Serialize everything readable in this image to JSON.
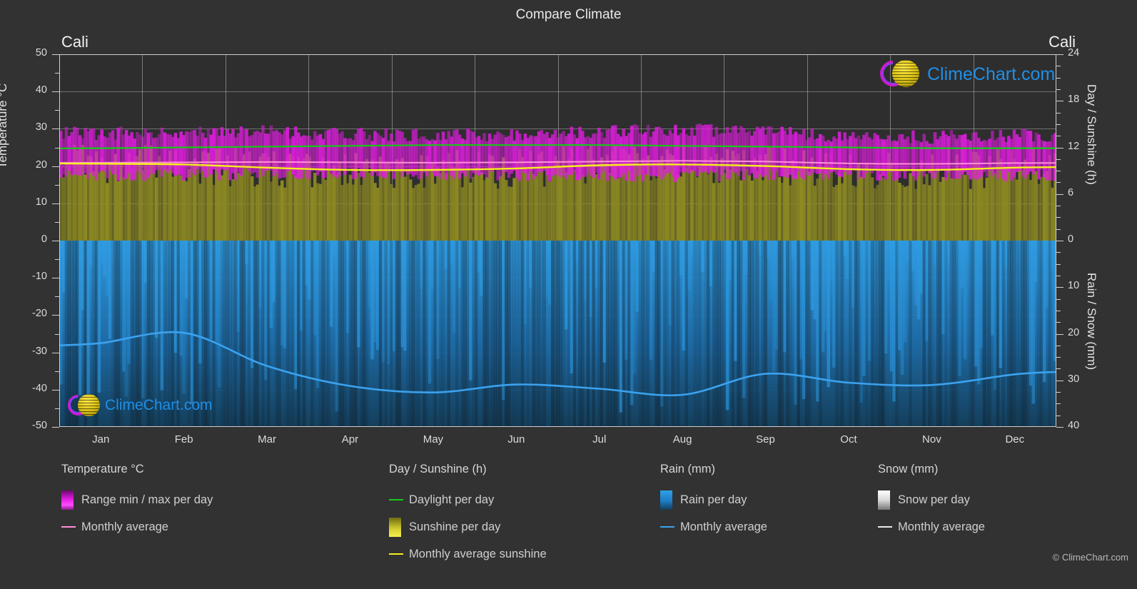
{
  "header": {
    "title": "Compare Climate",
    "location_left": "Cali",
    "location_right": "Cali"
  },
  "axes": {
    "left_title": "Temperature °C",
    "right_title_top": "Day / Sunshine (h)",
    "right_title_bottom": "Rain / Snow (mm)",
    "left_ticks": [
      "50",
      "40",
      "30",
      "20",
      "10",
      "0",
      "-10",
      "-20",
      "-30",
      "-40",
      "-50"
    ],
    "right_ticks_top": [
      "24",
      "18",
      "12",
      "6",
      "0"
    ],
    "right_ticks_bottom": [
      "10",
      "20",
      "30",
      "40"
    ],
    "x_ticks": [
      "Jan",
      "Feb",
      "Mar",
      "Apr",
      "May",
      "Jun",
      "Jul",
      "Aug",
      "Sep",
      "Oct",
      "Nov",
      "Dec"
    ]
  },
  "legend": {
    "temperature": {
      "head": "Temperature °C",
      "items": [
        {
          "label": "Range min / max per day",
          "swatch": "gradient-magenta"
        },
        {
          "label": "Monthly average",
          "swatch": "line-pink"
        }
      ]
    },
    "daysun": {
      "head": "Day / Sunshine (h)",
      "items": [
        {
          "label": "Daylight per day",
          "swatch": "line-green"
        },
        {
          "label": "Sunshine per day",
          "swatch": "gradient-yellow"
        },
        {
          "label": "Monthly average sunshine",
          "swatch": "line-yellow"
        }
      ]
    },
    "rain": {
      "head": "Rain (mm)",
      "items": [
        {
          "label": "Rain per day",
          "swatch": "gradient-blue"
        },
        {
          "label": "Monthly average",
          "swatch": "line-blue"
        }
      ]
    },
    "snow": {
      "head": "Snow (mm)",
      "items": [
        {
          "label": "Snow per day",
          "swatch": "gradient-white"
        },
        {
          "label": "Monthly average",
          "swatch": "line-white"
        }
      ]
    },
    "copyright": "© ClimeChart.com"
  },
  "watermark": {
    "text": "ClimeChart.com"
  },
  "colors": {
    "background": "#323232",
    "plot_background": "#2e2e2e",
    "grid": "#d7d7d7",
    "temp_range": "#e21ce2",
    "temp_avg": "#ff8fd8",
    "daylight": "#16c916",
    "sunshine": "#f2ee3a",
    "sunshine_avg": "#f5ef1e",
    "rain": "#1f8fe8",
    "rain_avg": "#3ba2ef",
    "snow": "#ffffff",
    "logo_text": "#1f8fe8",
    "logo_arc": "#d11ad1",
    "logo_sun": "#ddc416"
  },
  "chart_data": {
    "type": "area",
    "title": "Compare Climate",
    "subtitle": "Cali",
    "xlabel": "",
    "ylabel": "Temperature °C",
    "categories": [
      "Jan",
      "Feb",
      "Mar",
      "Apr",
      "May",
      "Jun",
      "Jul",
      "Aug",
      "Sep",
      "Oct",
      "Nov",
      "Dec"
    ],
    "ylim_temperature_c": [
      -50,
      50
    ],
    "ylim_day_sunshine_h": [
      0,
      24
    ],
    "ylim_rain_snow_mm": [
      0,
      40
    ],
    "grid": true,
    "legend_position": "below",
    "series": [
      {
        "name": "Monthly average temperature (°C)",
        "axis": "temperature",
        "color": "#ff8fd8",
        "values": [
          20.9,
          21.0,
          21.1,
          21.0,
          20.9,
          21.0,
          21.2,
          21.4,
          21.2,
          20.7,
          20.6,
          20.8
        ]
      },
      {
        "name": "Daily max temperature (°C)",
        "axis": "temperature",
        "color": "#e21ce2",
        "values": [
          28.8,
          29.3,
          29.2,
          28.6,
          28.2,
          28.5,
          29.3,
          29.8,
          29.2,
          28.0,
          27.8,
          28.3
        ]
      },
      {
        "name": "Daily min temperature (°C)",
        "axis": "temperature",
        "color": "#e21ce2",
        "values": [
          17.4,
          17.6,
          17.9,
          18.0,
          17.9,
          17.6,
          17.2,
          17.3,
          17.5,
          17.6,
          17.6,
          17.4
        ]
      },
      {
        "name": "Daylight per day (h)",
        "axis": "day_sunshine",
        "color": "#16c916",
        "values": [
          11.9,
          12.0,
          12.1,
          12.2,
          12.3,
          12.3,
          12.3,
          12.2,
          12.1,
          12.0,
          11.9,
          11.9
        ]
      },
      {
        "name": "Monthly average sunshine (h)",
        "axis": "day_sunshine",
        "color": "#f5ef1e",
        "values": [
          9.9,
          9.8,
          9.4,
          9.1,
          9.1,
          9.3,
          9.7,
          9.8,
          9.6,
          9.2,
          9.1,
          9.4
        ]
      },
      {
        "name": "Monthly average rain (mm)",
        "axis": "rain_snow",
        "color": "#3ba2ef",
        "values": [
          22.0,
          19.8,
          26.9,
          31.2,
          32.6,
          30.9,
          31.8,
          33.1,
          28.6,
          30.5,
          31.0,
          28.7
        ]
      },
      {
        "name": "Monthly average snow (mm)",
        "axis": "rain_snow",
        "color": "#ffffff",
        "values": [
          0,
          0,
          0,
          0,
          0,
          0,
          0,
          0,
          0,
          0,
          0,
          0
        ]
      }
    ]
  }
}
